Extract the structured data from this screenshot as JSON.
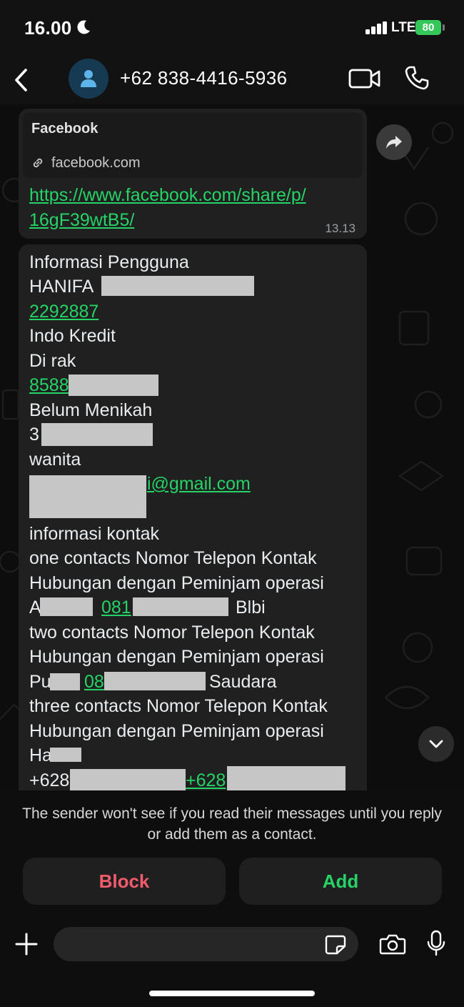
{
  "status_bar": {
    "time": "16.00",
    "network": "LTE",
    "battery": "80"
  },
  "header": {
    "contact_name": "+62 838-4416-5936"
  },
  "messages": {
    "link_message": {
      "preview_title": "Facebook",
      "preview_domain": "facebook.com",
      "url_line1": "https://www.facebook.com/share/p/",
      "url_line2": "16gF39wtB5/",
      "time": "13.13"
    },
    "info_message": {
      "l1": "Informasi Pengguna",
      "l2": "HANIFA",
      "l3": "2292887",
      "l4": "Indo Kredit",
      "l5": "Di rak",
      "l6": "8588",
      "l7": "Belum Menikah",
      "l8": "3",
      "l9": "wanita",
      "l10": "i@gmail.com",
      "l11": "informasi kontak",
      "l12": "one contacts Nomor Telepon Kontak",
      "l13": "Hubungan dengan Peminjam operasi",
      "l14a": "A",
      "l14b": "081",
      "l14c": "Blbi",
      "l15": "two contacts Nomor Telepon Kontak",
      "l16": "Hubungan dengan Peminjam operasi",
      "l17a": "Pu",
      "l17b": "08",
      "l17c": "Saudara",
      "l18": "three contacts Nomor Telepon Kontak",
      "l19": "Hubungan dengan Peminjam operasi",
      "l20": "Ha",
      "l21a": "+628",
      "l21b": "+628"
    }
  },
  "notice": {
    "text": "The sender won't see if you read their messages until you reply or add them as a contact."
  },
  "actions": {
    "block_label": "Block",
    "add_label": "Add"
  },
  "colors": {
    "accent_green": "#25d366",
    "block_red": "#f15c6d",
    "bubble_bg": "#202020"
  }
}
